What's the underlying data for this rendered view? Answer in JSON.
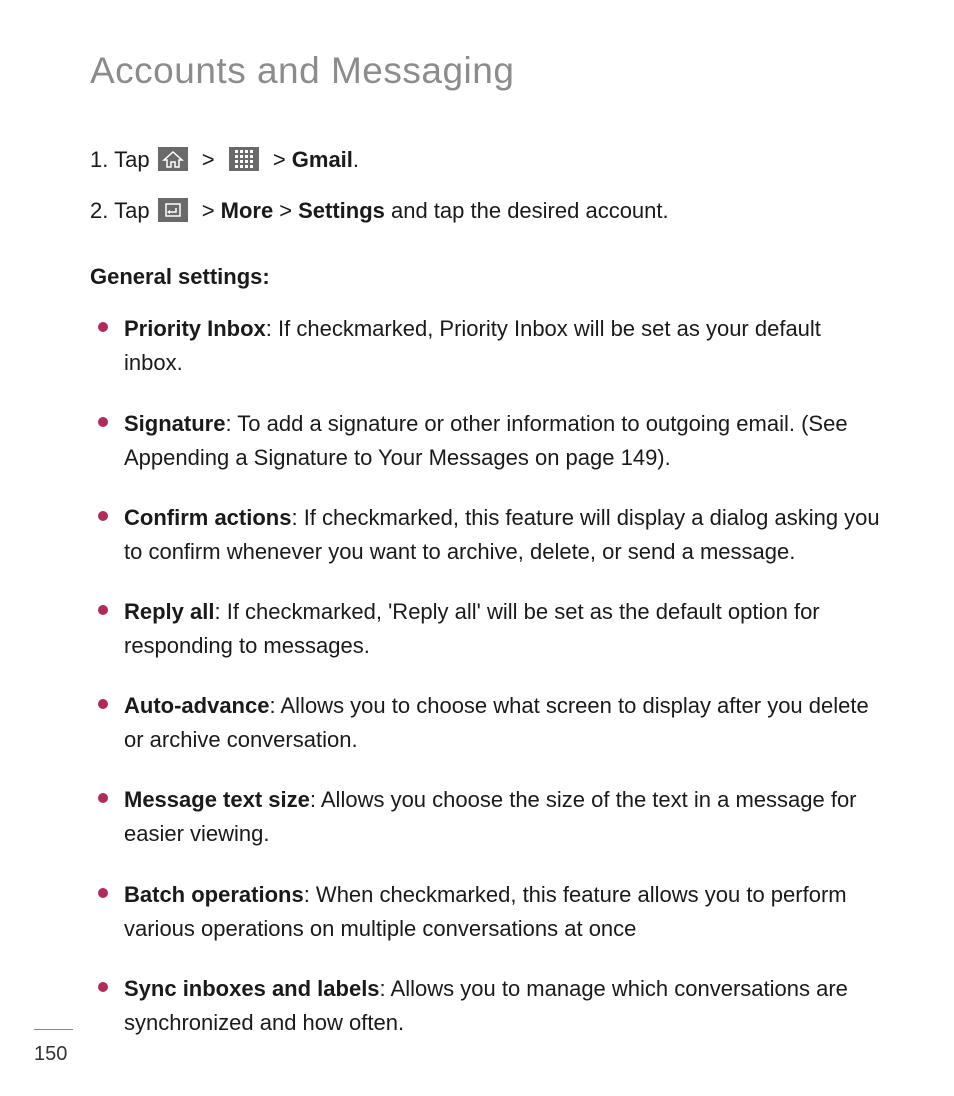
{
  "title": "Accounts and Messaging",
  "steps": [
    {
      "num": "1.",
      "lead": "Tap ",
      "seq": [
        {
          "type": "icon",
          "name": "home-icon"
        },
        {
          "type": "sep",
          "text": ">"
        },
        {
          "type": "icon",
          "name": "apps-grid-icon"
        },
        {
          "type": "sep",
          "text": ">"
        },
        {
          "type": "bold",
          "text": "Gmail"
        },
        {
          "type": "text",
          "text": "."
        }
      ]
    },
    {
      "num": "2.",
      "lead": "Tap ",
      "seq": [
        {
          "type": "icon",
          "name": "menu-return-icon"
        },
        {
          "type": "sep",
          "text": ">"
        },
        {
          "type": "bold",
          "text": "More"
        },
        {
          "type": "sep",
          "text": ">"
        },
        {
          "type": "bold",
          "text": "Settings"
        },
        {
          "type": "text",
          "text": " and tap the desired account."
        }
      ]
    }
  ],
  "subhead": "General settings:",
  "bullets": [
    {
      "label": "Priority Inbox",
      "desc": ": If checkmarked, Priority Inbox will be set as your default inbox."
    },
    {
      "label": "Signature",
      "desc": ": To add a signature or other information to outgoing email. (See Appending a Signature to Your Messages on page 149)."
    },
    {
      "label": "Confirm actions",
      "desc": ": If checkmarked, this feature will display a dialog asking you to confirm whenever you want to archive, delete, or send a message."
    },
    {
      "label": "Reply all",
      "desc": ": If checkmarked, 'Reply all' will be set as the default option for responding to messages."
    },
    {
      "label": "Auto-advance",
      "desc": ": Allows you to choose what screen to display after you delete or archive conversation."
    },
    {
      "label": "Message text size",
      "desc": ": Allows you choose the size of the text in a message for easier viewing."
    },
    {
      "label": "Batch operations",
      "desc": ": When checkmarked, this feature allows you to perform various operations on multiple conversations at once"
    },
    {
      "label": "Sync inboxes and labels",
      "desc": ": Allows you to manage which conversations are synchronized and how often."
    }
  ],
  "page_number": "150",
  "icons": {
    "home-icon": "home",
    "apps-grid-icon": "grid",
    "menu-return-icon": "return"
  }
}
